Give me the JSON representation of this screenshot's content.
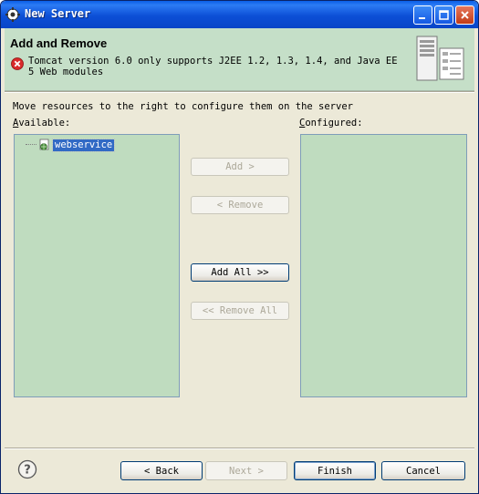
{
  "window": {
    "title": "New Server"
  },
  "header": {
    "title": "Add and Remove",
    "message": "Tomcat version 6.0 only supports J2EE 1.2, 1.3, 1.4, and Java EE 5 Web modules",
    "message_icon": "error-icon",
    "graphic": "server-graphic"
  },
  "main": {
    "instruction": "Move resources to the right to configure them on the server",
    "available_label": "Available:",
    "configured_label": "Configured:",
    "available_items": [
      {
        "label": "webservice",
        "icon": "web-module-icon",
        "selected": true
      }
    ],
    "configured_items": [],
    "buttons": {
      "add": "Add >",
      "remove": "< Remove",
      "add_all": "Add All >>",
      "remove_all": "<< Remove All"
    }
  },
  "footer": {
    "help_icon": "help-icon",
    "back": "< Back",
    "next": "Next >",
    "finish": "Finish",
    "cancel": "Cancel"
  },
  "colors": {
    "titlebar": "#0845c8",
    "header_bg": "#c5dfc8",
    "panel_bg": "#bfdcbf",
    "selection": "#316ac5",
    "dialog_bg": "#ece9d8"
  }
}
